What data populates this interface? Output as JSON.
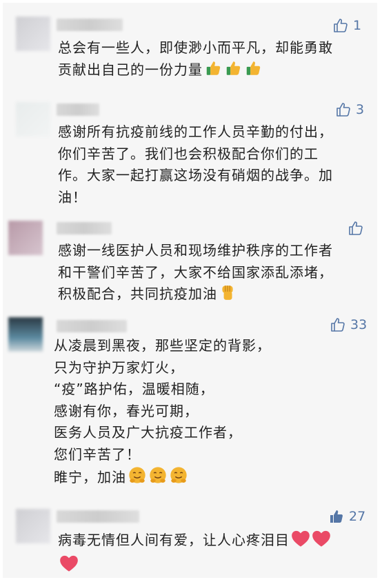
{
  "comments": [
    {
      "likes": "1",
      "liked": false,
      "lines": [
        "总会有一些人，即使渺小而平凡，却能勇敢",
        "贡献出自己的一份力量"
      ],
      "emoji": [
        "thumbs-up",
        "thumbs-up",
        "thumbs-up"
      ]
    },
    {
      "likes": "3",
      "liked": false,
      "lines": [
        "感谢所有抗疫前线的工作人员辛勤的付出，",
        "你们辛苦了。我们也会积极配合你们的工",
        "作。大家一起打赢这场没有硝烟的战争。加",
        "油！"
      ],
      "emoji": []
    },
    {
      "likes": "",
      "liked": false,
      "lines": [
        "感谢一线医护人员和现场维护秩序的工作者",
        "和干警们辛苦了，大家不给国家添乱添堵，",
        "积极配合，共同抗疫加油"
      ],
      "emoji": [
        "raised-fist"
      ]
    },
    {
      "likes": "33",
      "liked": false,
      "lines": [
        "从凌晨到黑夜，那些坚定的背影，",
        "只为守护万家灯火，",
        "“疫”路护佑，温暖相随，",
        "感谢有你，春光可期，",
        "医务人员及广大抗疫工作者，",
        "您们辛苦了！",
        "睢宁，加油"
      ],
      "emoji": [
        "hugging-face",
        "hugging-face",
        "hugging-face"
      ]
    },
    {
      "likes": "27",
      "liked": true,
      "lines": [
        "病毒无情但人间有爱，让人心疼泪目",
        ""
      ],
      "emoji": [
        "heart",
        "heart",
        "heart"
      ]
    }
  ],
  "colors": {
    "background": "#f6f6f6",
    "text": "#222222",
    "like": "#5576a6",
    "heart": "#ea4a66",
    "thumb_emoji": "#f3b431"
  }
}
